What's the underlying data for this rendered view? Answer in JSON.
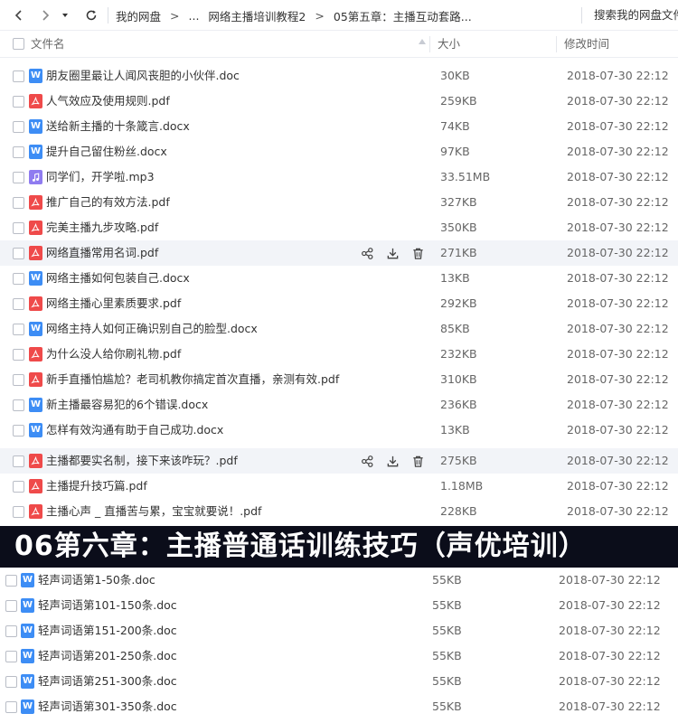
{
  "toolbar": {
    "breadcrumb": [
      "我的网盘",
      "...",
      "网络主播培训教程2",
      "05第五章：主播互动套路..."
    ],
    "search_label": "搜索我的网盘文件"
  },
  "header": {
    "name": "文件名",
    "size": "大小",
    "time": "修改时间"
  },
  "files": [
    {
      "name": "朋友圈里最让人闻风丧胆的小伙伴.doc",
      "type": "doc",
      "size": "30KB",
      "time": "2018-07-30 22:12"
    },
    {
      "name": "人气效应及使用规则.pdf",
      "type": "pdf",
      "size": "259KB",
      "time": "2018-07-30 22:12"
    },
    {
      "name": "送给新主播的十条箴言.docx",
      "type": "doc",
      "size": "74KB",
      "time": "2018-07-30 22:12"
    },
    {
      "name": "提升自己留住粉丝.docx",
      "type": "doc",
      "size": "97KB",
      "time": "2018-07-30 22:12"
    },
    {
      "name": "同学们，开学啦.mp3",
      "type": "mp3",
      "size": "33.51MB",
      "time": "2018-07-30 22:12"
    },
    {
      "name": "推广自己的有效方法.pdf",
      "type": "pdf",
      "size": "327KB",
      "time": "2018-07-30 22:12"
    },
    {
      "name": "完美主播九步攻略.pdf",
      "type": "pdf",
      "size": "350KB",
      "time": "2018-07-30 22:12"
    },
    {
      "name": "网络直播常用名词.pdf",
      "type": "pdf",
      "size": "271KB",
      "time": "2018-07-30 22:12",
      "hover": true
    },
    {
      "name": "网络主播如何包装自己.docx",
      "type": "doc",
      "size": "13KB",
      "time": "2018-07-30 22:12"
    },
    {
      "name": "网络主播心里素质要求.pdf",
      "type": "pdf",
      "size": "292KB",
      "time": "2018-07-30 22:12"
    },
    {
      "name": "网络主持人如何正确识别自己的脸型.docx",
      "type": "doc",
      "size": "85KB",
      "time": "2018-07-30 22:12"
    },
    {
      "name": "为什么没人给你刷礼物.pdf",
      "type": "pdf",
      "size": "232KB",
      "time": "2018-07-30 22:12"
    },
    {
      "name": "新手直播怕尴尬？老司机教你搞定首次直播，亲测有效.pdf",
      "type": "pdf",
      "size": "310KB",
      "time": "2018-07-30 22:12"
    },
    {
      "name": "新主播最容易犯的6个错误.docx",
      "type": "doc",
      "size": "236KB",
      "time": "2018-07-30 22:12"
    },
    {
      "name": "怎样有效沟通有助于自己成功.docx",
      "type": "doc",
      "size": "13KB",
      "time": "2018-07-30 22:12"
    }
  ],
  "files_b": [
    {
      "name": "主播都要实名制，接下来该咋玩？.pdf",
      "type": "pdf",
      "size": "275KB",
      "time": "2018-07-30 22:12",
      "hover": true
    },
    {
      "name": "主播提升技巧篇.pdf",
      "type": "pdf",
      "size": "1.18MB",
      "time": "2018-07-30 22:12"
    },
    {
      "name": "主播心声 _ 直播苦与累，宝宝就要说！.pdf",
      "type": "pdf",
      "size": "228KB",
      "time": "2018-07-30 22:12"
    }
  ],
  "chapter_banner": "06第六章：主播普通话训练技巧（声优培训）",
  "files_c": [
    {
      "name": "轻声词语第1-50条.doc",
      "type": "doc",
      "size": "55KB",
      "time": "2018-07-30 22:12"
    },
    {
      "name": "轻声词语第101-150条.doc",
      "type": "doc",
      "size": "55KB",
      "time": "2018-07-30 22:12"
    },
    {
      "name": "轻声词语第151-200条.doc",
      "type": "doc",
      "size": "55KB",
      "time": "2018-07-30 22:12"
    },
    {
      "name": "轻声词语第201-250条.doc",
      "type": "doc",
      "size": "55KB",
      "time": "2018-07-30 22:12"
    },
    {
      "name": "轻声词语第251-300条.doc",
      "type": "doc",
      "size": "55KB",
      "time": "2018-07-30 22:12"
    },
    {
      "name": "轻声词语第301-350条.doc",
      "type": "doc",
      "size": "55KB",
      "time": "2018-07-30 22:12"
    }
  ],
  "icons": {
    "doc": "word-doc-icon",
    "pdf": "pdf-file-icon",
    "mp3": "audio-file-icon"
  }
}
